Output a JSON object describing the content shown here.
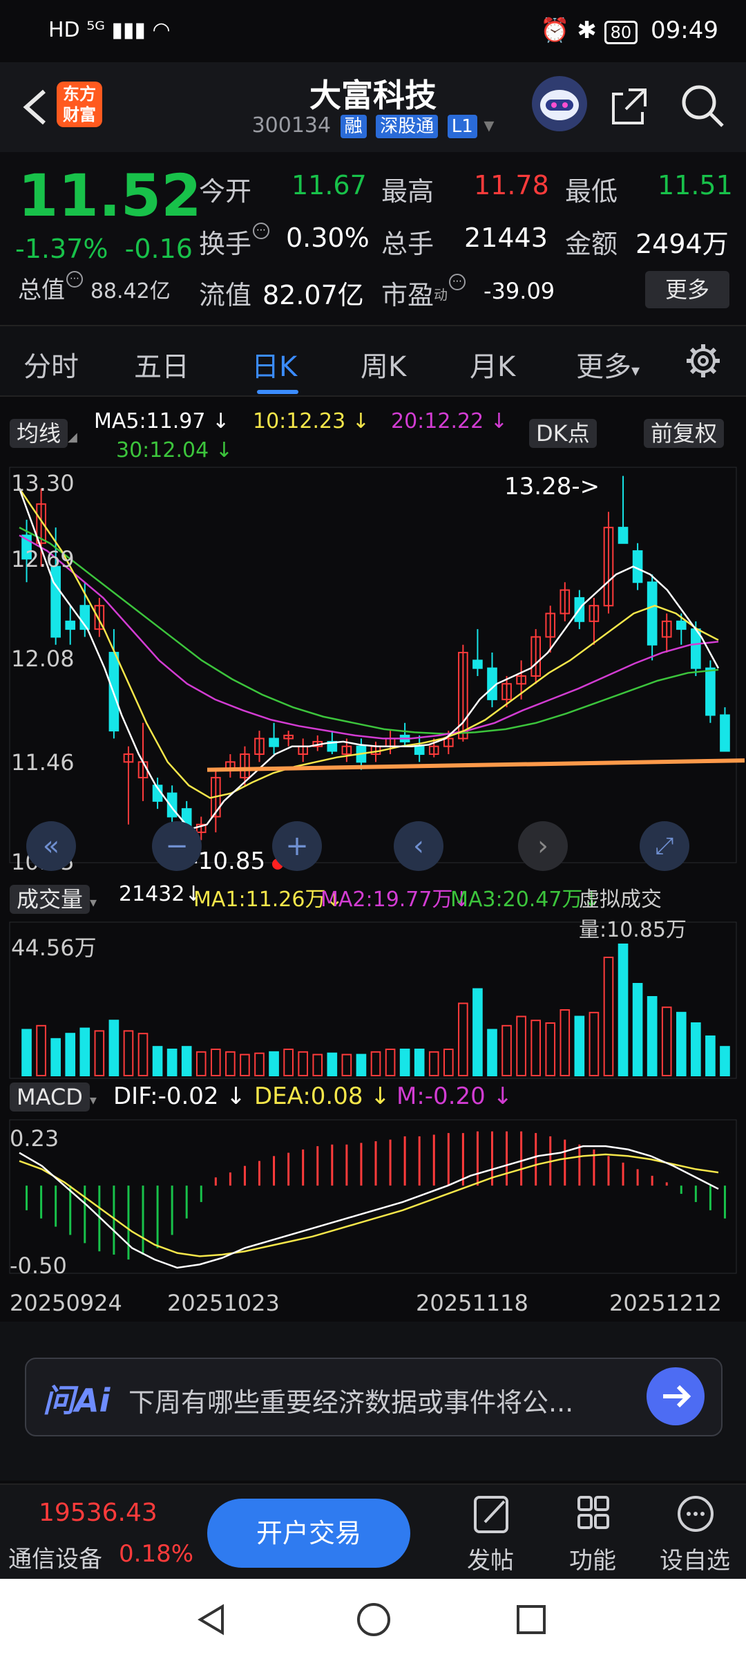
{
  "status_bar": {
    "left": "HD ⁵ᴳ ▮▮▮ ◠",
    "battery": "80",
    "time": "09:49"
  },
  "header": {
    "logo_line1": "东方",
    "logo_line2": "财富",
    "title": "大富科技",
    "code": "300134",
    "tag1": "融",
    "tag2": "深股通",
    "tag3": "L1"
  },
  "quote": {
    "price": "11.52",
    "change_pct": "-1.37%",
    "change": "-0.16",
    "open_label": "今开",
    "open": "11.67",
    "high_label": "最高",
    "high": "11.78",
    "low_label": "最低",
    "low": "11.51",
    "turnover_label": "换手",
    "turnover": "0.30%",
    "volume_label": "总手",
    "volume": "21443",
    "amount_label": "金额",
    "amount": "2494万",
    "mktcap_label": "总值",
    "mktcap": "88.42亿",
    "float_label": "流值",
    "float": "82.07亿",
    "pe_label": "市盈",
    "pe_sup": "动",
    "pe": "-39.09",
    "more": "更多"
  },
  "tabs": [
    "分时",
    "五日",
    "日K",
    "周K",
    "月K",
    "更多"
  ],
  "chart": {
    "ma_pill": "均线",
    "ma5": "MA5:11.97",
    "ma10": "10:12.23",
    "ma20": "20:12.22",
    "ma30": "30:12.04",
    "dk_pill": "DK点",
    "fq_pill": "前复权",
    "y_labels": [
      "13.30",
      "12.69",
      "12.08",
      "11.46",
      "10.85"
    ],
    "high_mark": "13.28->",
    "low_mark": "<-10.85",
    "vol_pill": "成交量",
    "vol_val": "21432",
    "vol_ma1": "MA1:11.26万",
    "vol_ma2": "MA2:19.77万",
    "vol_ma3": "MA3:20.47万",
    "vol_virtual": "虚拟成交量:10.85万",
    "vol_max": "44.56万",
    "macd_pill": "MACD",
    "dif": "DIF:-0.02",
    "dea": "DEA:0.08",
    "m": "M:-0.20",
    "macd_top": "0.23",
    "macd_bottom": "-0.50",
    "dates": [
      "20250924",
      "20251023",
      "20251118",
      "20251212"
    ]
  },
  "chart_data": {
    "type": "candlestick",
    "ylim": [
      10.85,
      13.3
    ],
    "candles": [
      [
        12.9,
        13.0,
        12.6,
        12.75
      ],
      [
        12.85,
        13.2,
        12.7,
        13.1
      ],
      [
        12.7,
        12.95,
        12.2,
        12.25
      ],
      [
        12.35,
        12.45,
        12.2,
        12.3
      ],
      [
        12.45,
        12.6,
        12.25,
        12.3
      ],
      [
        12.3,
        12.5,
        12.25,
        12.45
      ],
      [
        12.15,
        12.3,
        11.6,
        11.65
      ],
      [
        11.45,
        11.55,
        11.05,
        11.5
      ],
      [
        11.35,
        11.7,
        11.2,
        11.45
      ],
      [
        11.3,
        11.35,
        11.15,
        11.2
      ],
      [
        11.25,
        11.3,
        11.0,
        11.1
      ],
      [
        11.15,
        11.2,
        10.85,
        10.9
      ],
      [
        11.0,
        11.1,
        10.95,
        11.05
      ],
      [
        11.1,
        11.4,
        11.0,
        11.35
      ],
      [
        11.4,
        11.5,
        11.35,
        11.45
      ],
      [
        11.35,
        11.55,
        11.3,
        11.5
      ],
      [
        11.5,
        11.65,
        11.45,
        11.6
      ],
      [
        11.6,
        11.7,
        11.5,
        11.55
      ],
      [
        11.6,
        11.65,
        11.55,
        11.62
      ],
      [
        11.5,
        11.6,
        11.45,
        11.55
      ],
      [
        11.55,
        11.62,
        11.52,
        11.58
      ],
      [
        11.58,
        11.65,
        11.5,
        11.52
      ],
      [
        11.5,
        11.6,
        11.45,
        11.55
      ],
      [
        11.55,
        11.6,
        11.4,
        11.45
      ],
      [
        11.5,
        11.58,
        11.45,
        11.55
      ],
      [
        11.55,
        11.65,
        11.5,
        11.6
      ],
      [
        11.62,
        11.7,
        11.55,
        11.58
      ],
      [
        11.55,
        11.62,
        11.45,
        11.5
      ],
      [
        11.5,
        11.6,
        11.48,
        11.55
      ],
      [
        11.55,
        11.65,
        11.5,
        11.6
      ],
      [
        11.6,
        12.2,
        11.58,
        12.15
      ],
      [
        12.1,
        12.3,
        12.0,
        12.05
      ],
      [
        12.05,
        12.15,
        11.8,
        11.85
      ],
      [
        11.85,
        12.0,
        11.8,
        11.95
      ],
      [
        11.95,
        12.1,
        11.85,
        12.0
      ],
      [
        12.0,
        12.3,
        11.95,
        12.25
      ],
      [
        12.25,
        12.45,
        12.15,
        12.4
      ],
      [
        12.4,
        12.6,
        12.35,
        12.55
      ],
      [
        12.5,
        12.55,
        12.3,
        12.35
      ],
      [
        12.35,
        12.5,
        12.2,
        12.45
      ],
      [
        12.45,
        13.05,
        12.4,
        12.95
      ],
      [
        12.95,
        13.28,
        12.85,
        12.85
      ],
      [
        12.8,
        12.85,
        12.55,
        12.6
      ],
      [
        12.6,
        12.65,
        12.1,
        12.2
      ],
      [
        12.25,
        12.4,
        12.15,
        12.35
      ],
      [
        12.35,
        12.4,
        12.2,
        12.3
      ],
      [
        12.3,
        12.35,
        12.0,
        12.05
      ],
      [
        12.05,
        12.1,
        11.7,
        11.75
      ],
      [
        11.75,
        11.8,
        11.52,
        11.52
      ]
    ],
    "ma5": [
      13.2,
      12.9,
      12.6,
      12.45,
      12.3,
      12.05,
      11.75,
      11.5,
      11.3,
      11.15,
      11.02,
      11.05,
      11.2,
      11.3,
      11.4,
      11.5,
      11.55,
      11.55,
      11.57,
      11.58,
      11.56,
      11.55,
      11.55,
      11.55,
      11.56,
      11.6,
      11.7,
      11.85,
      11.95,
      12.0,
      12.05,
      12.15,
      12.3,
      12.45,
      12.55,
      12.65,
      12.7,
      12.65,
      12.55,
      12.4,
      12.25,
      12.05
    ],
    "ma10": [
      13.2,
      13.0,
      12.8,
      12.55,
      12.3,
      12.0,
      11.7,
      11.45,
      11.3,
      11.22,
      11.25,
      11.32,
      11.38,
      11.42,
      11.45,
      11.48,
      11.5,
      11.52,
      11.55,
      11.57,
      11.6,
      11.65,
      11.72,
      11.82,
      11.92,
      12.02,
      12.1,
      12.2,
      12.3,
      12.4,
      12.45,
      12.4,
      12.3,
      12.23
    ],
    "ma20": [
      12.9,
      12.8,
      12.65,
      12.5,
      12.3,
      12.1,
      11.95,
      11.85,
      11.78,
      11.72,
      11.68,
      11.65,
      11.62,
      11.6,
      11.6,
      11.62,
      11.65,
      11.7,
      11.78,
      11.85,
      11.92,
      12.0,
      12.08,
      12.15,
      12.2,
      12.22
    ],
    "ma30": [
      12.95,
      12.85,
      12.7,
      12.55,
      12.4,
      12.25,
      12.1,
      11.98,
      11.88,
      11.8,
      11.74,
      11.7,
      11.66,
      11.64,
      11.63,
      11.64,
      11.66,
      11.7,
      11.76,
      11.83,
      11.9,
      11.97,
      12.02,
      12.04
    ],
    "volume": [
      0.35,
      0.38,
      0.28,
      0.32,
      0.36,
      0.34,
      0.42,
      0.34,
      0.32,
      0.22,
      0.2,
      0.22,
      0.18,
      0.2,
      0.18,
      0.16,
      0.17,
      0.18,
      0.2,
      0.18,
      0.16,
      0.17,
      0.16,
      0.16,
      0.18,
      0.2,
      0.2,
      0.2,
      0.18,
      0.2,
      0.55,
      0.66,
      0.35,
      0.38,
      0.45,
      0.42,
      0.4,
      0.5,
      0.45,
      0.48,
      0.9,
      1.0,
      0.7,
      0.6,
      0.52,
      0.48,
      0.4,
      0.3,
      0.22
    ],
    "macd_hist": [
      -0.15,
      -0.2,
      -0.25,
      -0.3,
      -0.35,
      -0.4,
      -0.42,
      -0.45,
      -0.42,
      -0.38,
      -0.3,
      -0.2,
      -0.1,
      0.05,
      0.08,
      0.12,
      0.15,
      0.18,
      0.2,
      0.22,
      0.24,
      0.25,
      0.25,
      0.26,
      0.27,
      0.28,
      0.3,
      0.3,
      0.31,
      0.32,
      0.32,
      0.33,
      0.33,
      0.33,
      0.33,
      0.32,
      0.3,
      0.28,
      0.25,
      0.22,
      0.18,
      0.14,
      0.1,
      0.06,
      0.02,
      -0.05,
      -0.1,
      -0.15,
      -0.2
    ],
    "dif": [
      0.2,
      0.12,
      0.0,
      -0.12,
      -0.25,
      -0.38,
      -0.45,
      -0.5,
      -0.48,
      -0.44,
      -0.38,
      -0.34,
      -0.3,
      -0.26,
      -0.22,
      -0.18,
      -0.14,
      -0.1,
      -0.05,
      0.0,
      0.06,
      0.1,
      0.14,
      0.18,
      0.2,
      0.24,
      0.24,
      0.22,
      0.18,
      0.12,
      0.05,
      -0.02
    ],
    "dea": [
      0.15,
      0.1,
      0.02,
      -0.08,
      -0.18,
      -0.28,
      -0.36,
      -0.41,
      -0.43,
      -0.42,
      -0.4,
      -0.37,
      -0.34,
      -0.31,
      -0.27,
      -0.23,
      -0.19,
      -0.15,
      -0.1,
      -0.05,
      0.0,
      0.05,
      0.09,
      0.13,
      0.16,
      0.18,
      0.19,
      0.18,
      0.16,
      0.13,
      0.1,
      0.08
    ]
  },
  "ai_bar": {
    "logo": "问Ai",
    "text": "下周有哪些重要经济数据或事件将公..."
  },
  "bottom_bar": {
    "index": "19536.43",
    "index_name": "通信设备",
    "index_pct": "0.18%",
    "trade": "开户交易",
    "post": "发帖",
    "func": "功能",
    "watch": "设自选"
  },
  "colors": {
    "up": "#ff3b3b",
    "down": "#18c14a",
    "candle_down": "#16e5e8",
    "ma5": "#ffffff",
    "ma10": "#f5e64a",
    "ma20": "#d23cd2",
    "ma30": "#3cc43c",
    "support": "#ff9a4a"
  }
}
